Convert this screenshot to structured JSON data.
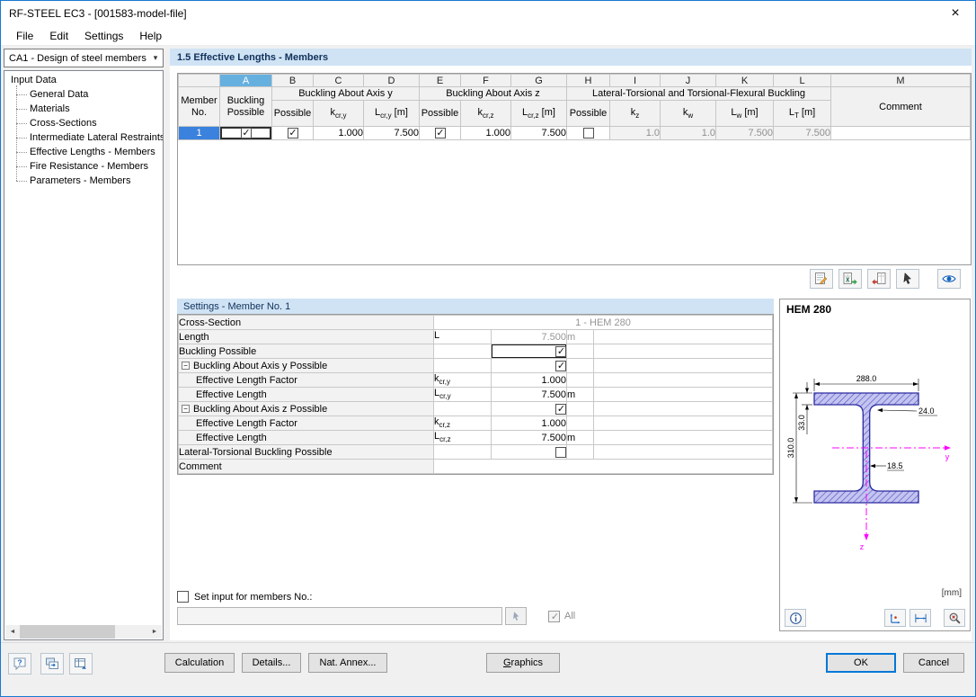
{
  "window": {
    "title": "RF-STEEL EC3 - [001583-model-file]",
    "close_glyph": "×"
  },
  "menu": {
    "items": [
      {
        "label": "File"
      },
      {
        "label": "Edit"
      },
      {
        "label": "Settings"
      },
      {
        "label": "Help"
      }
    ]
  },
  "sidebar": {
    "case_selector": {
      "value": "CA1 - Design of steel members",
      "arrow_glyph": "▾"
    },
    "tree": {
      "root": "Input Data",
      "items": [
        {
          "label": "General Data"
        },
        {
          "label": "Materials"
        },
        {
          "label": "Cross-Sections"
        },
        {
          "label": "Intermediate Lateral Restraints"
        },
        {
          "label": "Effective Lengths - Members"
        },
        {
          "label": "Fire Resistance - Members"
        },
        {
          "label": "Parameters - Members"
        }
      ]
    },
    "scrollbar": {
      "left_glyph": "◄",
      "right_glyph": "►"
    }
  },
  "section_header": {
    "title": "1.5 Effective Lengths - Members"
  },
  "table": {
    "letters": [
      "A",
      "B",
      "C",
      "D",
      "E",
      "F",
      "G",
      "H",
      "I",
      "J",
      "K",
      "L",
      "M"
    ],
    "member_header": {
      "line1": "Member",
      "line2": "No."
    },
    "headers": {
      "buckling_line1": "Buckling",
      "buckling_line2": "Possible",
      "group_axis_y": "Buckling About Axis y",
      "group_axis_z": "Buckling About Axis z",
      "group_ltb": "Lateral-Torsional and Torsional-Flexural Buckling",
      "possible": "Possible",
      "k_cr_y": {
        "base": "k",
        "sub": "cr,y",
        "rest": ""
      },
      "L_cr_y": {
        "base": "L",
        "sub": "cr,y",
        "rest": " [m]"
      },
      "k_cr_z": {
        "base": "k",
        "sub": "cr,z",
        "rest": ""
      },
      "L_cr_z": {
        "base": "L",
        "sub": "cr,z",
        "rest": " [m]"
      },
      "k_z": {
        "base": "k",
        "sub": "z",
        "rest": ""
      },
      "k_w": {
        "base": "k",
        "sub": "w",
        "rest": ""
      },
      "L_w": {
        "base": "L",
        "sub": "w",
        "rest": " [m]"
      },
      "L_T": {
        "base": "L",
        "sub": "T",
        "rest": " [m]"
      },
      "comment": "Comment"
    },
    "rows": [
      {
        "no": "1",
        "buckling_possible": true,
        "axis_y_possible": true,
        "k_cr_y": "1.000",
        "L_cr_y": "7.500",
        "axis_z_possible": true,
        "k_cr_z": "1.000",
        "L_cr_z": "7.500",
        "ltb_possible": false,
        "k_z": "1.0",
        "k_w": "1.0",
        "L_w": "7.500",
        "L_T": "7.500",
        "comment": ""
      }
    ]
  },
  "settings": {
    "title": "Settings - Member No. 1",
    "expander_glyph": "−",
    "rows": [
      {
        "label": "Cross-Section",
        "value": "1 - HEM 280"
      },
      {
        "label": "Length",
        "symbol_base": "L",
        "symbol_sub": "",
        "value": "7.500",
        "unit": "m"
      },
      {
        "label": "Buckling Possible",
        "checked": true
      },
      {
        "label": "Buckling About Axis y Possible",
        "checked": true
      },
      {
        "label": "Effective Length Factor",
        "symbol_base": "k",
        "symbol_sub": "cr,y",
        "value": "1.000",
        "unit": ""
      },
      {
        "label": "Effective Length",
        "symbol_base": "L",
        "symbol_sub": "cr,y",
        "value": "7.500",
        "unit": "m"
      },
      {
        "label": "Buckling About Axis z Possible",
        "checked": true
      },
      {
        "label": "Effective Length Factor",
        "symbol_base": "k",
        "symbol_sub": "cr,z",
        "value": "1.000",
        "unit": ""
      },
      {
        "label": "Effective Length",
        "symbol_base": "L",
        "symbol_sub": "cr,z",
        "value": "7.500",
        "unit": "m"
      },
      {
        "label": "Lateral-Torsional Buckling Possible",
        "checked": false
      },
      {
        "label": "Comment",
        "value": ""
      }
    ]
  },
  "footer_controls": {
    "set_input_label": "Set input for members No.:",
    "members_value": "",
    "all_label": "All"
  },
  "section_panel": {
    "title": "HEM 280",
    "units_label": "[mm]",
    "dims": {
      "width": "288.0",
      "flange_thickness": "33.0",
      "fillet_radius": "24.0",
      "height": "310.0",
      "web_thickness": "18.5"
    },
    "axes": {
      "y_label": "y",
      "z_label": "z"
    }
  },
  "bottom_bar": {
    "calculation": "Calculation",
    "details": "Details...",
    "nat_annex": "Nat. Annex...",
    "graphics_accel": "G",
    "graphics_rest": "raphics",
    "ok": "OK",
    "cancel": "Cancel"
  },
  "colors": {
    "window_border": "#1879d2",
    "header_blue": "#cfe3f5",
    "column_selected_blue": "#66b0e0",
    "row_selected_blue": "#3a82dd",
    "axis_magenta": "#ff00ff",
    "section_fill": "#c4c4f0",
    "section_outline": "#2a2aa0",
    "disabled_text": "#909090"
  }
}
